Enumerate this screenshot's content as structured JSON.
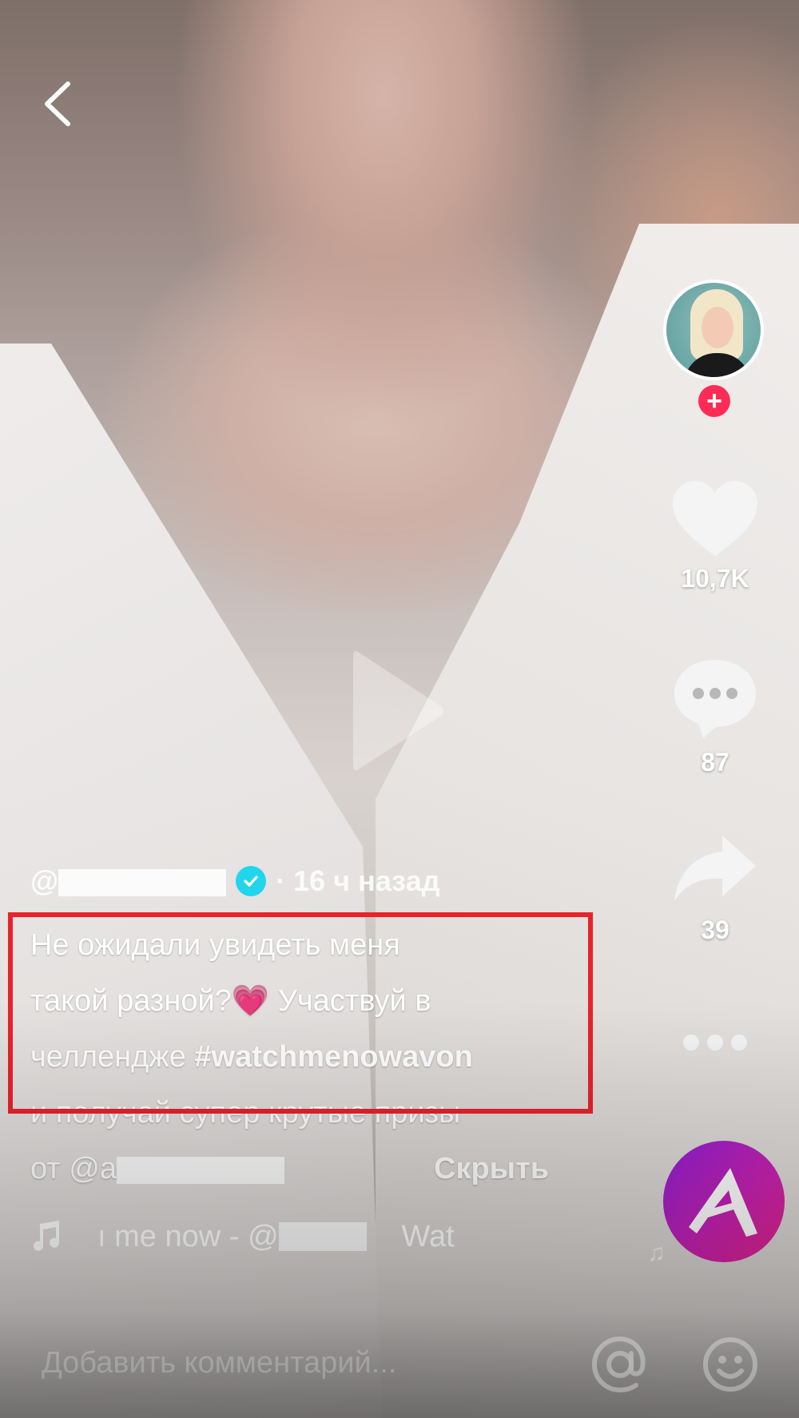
{
  "video": {
    "play_icon": "play-icon"
  },
  "nav": {
    "back_icon": "chevron-left-icon"
  },
  "author": {
    "handle_prefix": "@",
    "verified": true,
    "separator": "·",
    "time_ago": "16 ч назад"
  },
  "caption": {
    "line1": "Не ожидали увидеть меня",
    "line2_text": "такой разной?",
    "line2_emoji": "💗",
    "line2_rest": " Участвуй в",
    "line3_text": "челлендже ",
    "hashtag": "#watchmenowavon",
    "line4": "и получай супер крутые призы",
    "line5_prefix": "от ",
    "mention_prefix": "@a",
    "hide_label": "Скрыть"
  },
  "sidebar": {
    "follow_label": "+",
    "likes": "10,7K",
    "comments": "87",
    "shares": "39",
    "more_icon": "more-dots-icon"
  },
  "sound": {
    "prefix": "ı me now - @",
    "suffix": "Wat"
  },
  "comment_bar": {
    "placeholder": "Добавить комментарий..."
  },
  "colors": {
    "follow": "#fe2c55",
    "verified": "#20d5ec",
    "highlight": "#e8232a",
    "disc_start": "#8f1fd6",
    "disc_end": "#e8248a"
  }
}
